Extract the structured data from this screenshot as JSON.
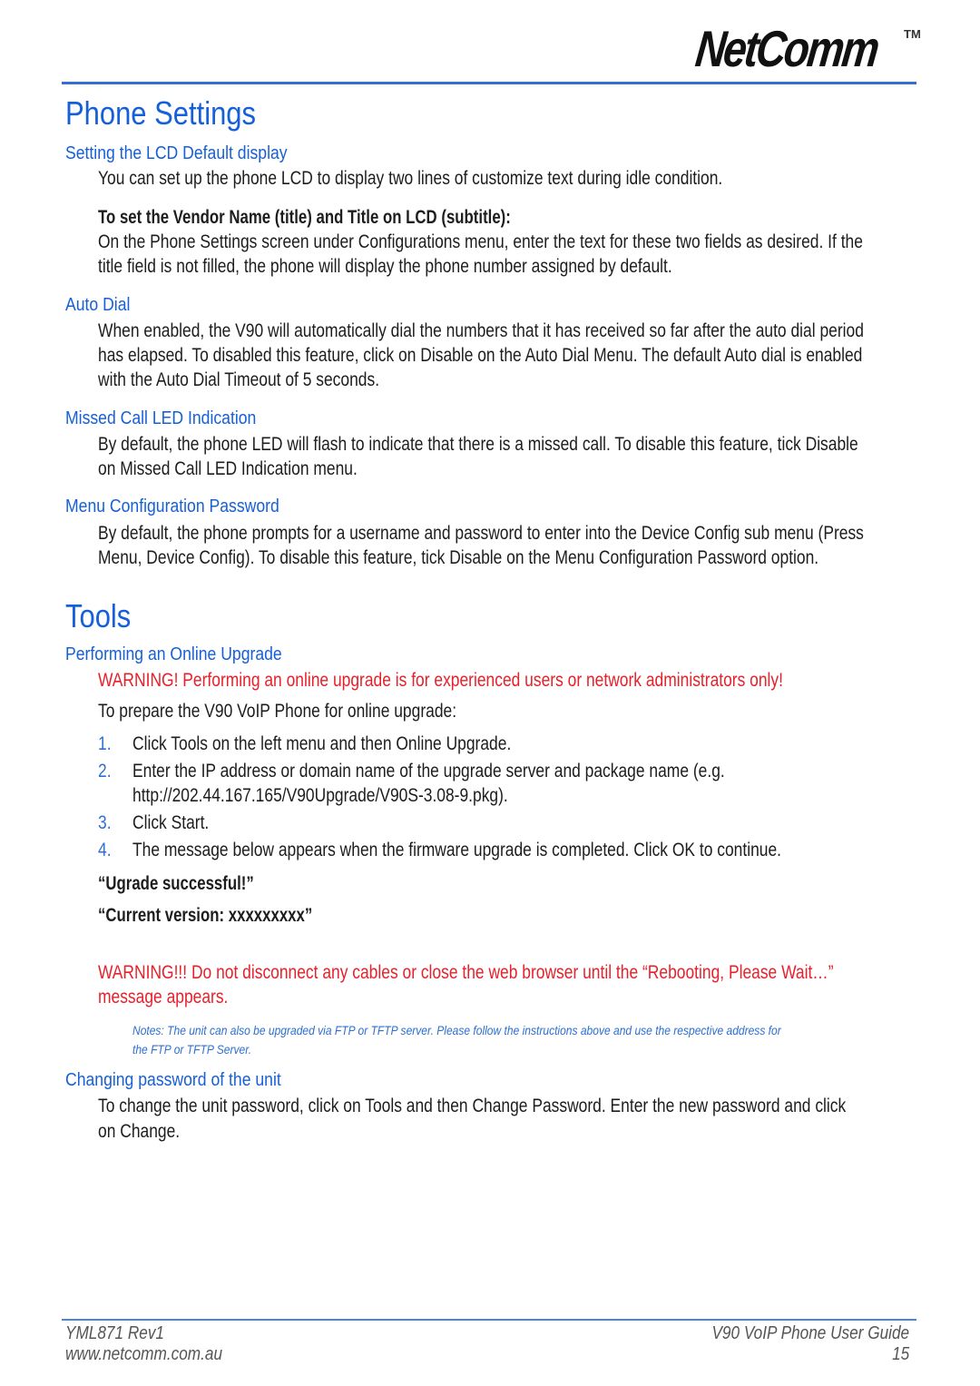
{
  "header": {
    "logo_text": "NetComm",
    "logo_tm": "TM",
    "brand_color": "#1560d8"
  },
  "phone_settings": {
    "title": "Phone Settings",
    "lcd": {
      "heading": "Setting the LCD Default display",
      "intro": "You can set up the phone LCD to display two lines of customize text during idle condition.",
      "subheading": "To set the Vendor Name (title) and Title on LCD (subtitle):",
      "body_line1": "On the Phone Settings screen under Configurations menu, enter the text for these two fields as desired.  If the",
      "body_line2": "title field is not filled, the phone will display the phone number assigned by default."
    },
    "auto_dial": {
      "heading": "Auto Dial",
      "line1": "When enabled, the V90 will automatically dial the numbers that it has received so far after the auto dial period",
      "line2": "has elapsed. To disabled this feature, click on Disable on the Auto Dial Menu. The default Auto dial is enabled",
      "line3": "with the Auto Dial Timeout of 5 seconds."
    },
    "missed_call": {
      "heading": "Missed Call LED Indication",
      "line1": "By default, the phone LED will flash to indicate that there is a missed call. To disable this feature, tick Disable",
      "line2": "on Missed Call LED Indication menu."
    },
    "menu_password": {
      "heading": "Menu Configuration Password",
      "line1": "By default, the phone prompts for a username and password to enter into the Device Config sub menu (Press",
      "line2": "Menu, Device Config). To disable this feature, tick Disable on the Menu Configuration Password option."
    }
  },
  "tools": {
    "title": "Tools",
    "online_upgrade": {
      "heading": "Performing an Online Upgrade",
      "warning": "WARNING! Performing an online upgrade is for experienced users or network administrators only!",
      "intro": "To prepare the V90 VoIP Phone for online upgrade:",
      "steps": [
        {
          "num": "1.",
          "lines": [
            "Click Tools on the left menu and then Online Upgrade."
          ]
        },
        {
          "num": "2.",
          "lines": [
            "Enter the IP address or domain name of the upgrade server and package name (e.g.",
            "http://202.44.167.165/V90Upgrade/V90S-3.08-9.pkg)."
          ]
        },
        {
          "num": "3.",
          "lines": [
            "Click Start."
          ]
        },
        {
          "num": "4.",
          "lines": [
            "The message below appears when the firmware upgrade is completed.  Click OK to continue."
          ]
        }
      ],
      "message1": "“Ugrade successful!”",
      "message2": "“Current version: xxxxxxxxx”",
      "warning2_line1": "WARNING!!! Do not disconnect any cables or close the web browser until the “Rebooting, Please Wait…”",
      "warning2_line2": "message appears.",
      "note_line1": "Notes: The unit can also be upgraded via FTP or TFTP server. Please follow the instructions above and use the respective address for",
      "note_line2": "the FTP or TFTP Server."
    },
    "change_password": {
      "heading": "Changing password of the unit",
      "line1": "To change the unit password, click on Tools and then Change Password. Enter the new password and click",
      "line2": "on Change."
    }
  },
  "footer": {
    "doc_code": "YML871 Rev1",
    "website": "www.netcomm.com.au",
    "guide_title": "V90 VoIP Phone User Guide",
    "page_number": "15"
  }
}
